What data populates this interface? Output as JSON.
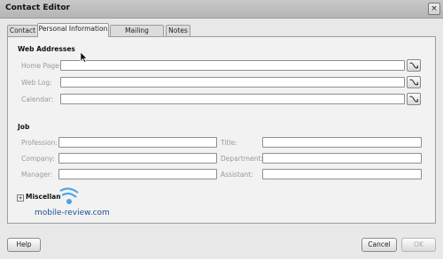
{
  "window": {
    "title": "Contact Editor",
    "close_glyph": "×"
  },
  "tabs": [
    {
      "label": "Contact"
    },
    {
      "label": "Personal Information",
      "active": true
    },
    {
      "label": "Mailing Address"
    },
    {
      "label": "Notes"
    }
  ],
  "web_section": {
    "title": "Web Addresses",
    "fields": [
      {
        "label": "Home Page:",
        "value": ""
      },
      {
        "label": "Web Log:",
        "value": ""
      },
      {
        "label": "Calendar:",
        "value": ""
      }
    ]
  },
  "job_section": {
    "title": "Job",
    "left": [
      {
        "label": "Profession:",
        "value": ""
      },
      {
        "label": "Company:",
        "value": ""
      },
      {
        "label": "Manager:",
        "value": ""
      }
    ],
    "right": [
      {
        "label": "Title:",
        "value": ""
      },
      {
        "label": "Department:",
        "value": ""
      },
      {
        "label": "Assistant:",
        "value": ""
      }
    ]
  },
  "misc": {
    "label": "Miscellan",
    "expander_glyph": "+"
  },
  "watermark": {
    "text": "mobile-review.com",
    "color": "#1f4f9a"
  },
  "footer": {
    "help": "Help",
    "cancel": "Cancel",
    "ok": "OK"
  },
  "colors": {
    "label_gray": "#9a9a9a",
    "panel": "#f2f2f2",
    "window": "#e8e8e8"
  }
}
